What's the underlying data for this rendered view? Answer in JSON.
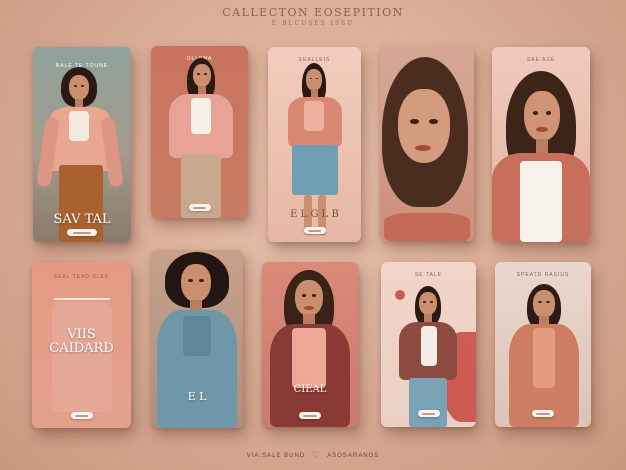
{
  "header": {
    "title": "CALLECTON EOSEPITION",
    "subtitle": "E BLCUSES ISSU"
  },
  "cards": [
    {
      "top_text": "BALE TE TOUNE",
      "main_text": "SAV TAL",
      "button": ""
    },
    {
      "top_text": "OLLENA",
      "main_text": "",
      "button": ""
    },
    {
      "top_text": "SEALLEIS",
      "main_text": "E L G L B",
      "button": ""
    },
    {
      "top_text": "",
      "main_text": "",
      "button": ""
    },
    {
      "top_text": "SAE ASE",
      "main_text": "",
      "button": ""
    },
    {
      "top_text": "SEAL TEAD SLEE",
      "main_text": "VIIS CAIDARD",
      "button": ""
    },
    {
      "top_text": "",
      "main_text": "E L",
      "button": ""
    },
    {
      "top_text": "",
      "main_text": "CIEAL",
      "button": ""
    },
    {
      "top_text": "SE TALE",
      "main_text": "",
      "button": ""
    },
    {
      "top_text": "SPEATD RASIUS",
      "main_text": "",
      "button": ""
    }
  ],
  "footer": {
    "left": "VIA:SALE BUND",
    "logo": "heart-hanger-logo",
    "right": "ASOSARANOS"
  },
  "colors": {
    "background": "#d8ab94",
    "accent": "#c9735f",
    "text_dark": "#6f4436"
  }
}
